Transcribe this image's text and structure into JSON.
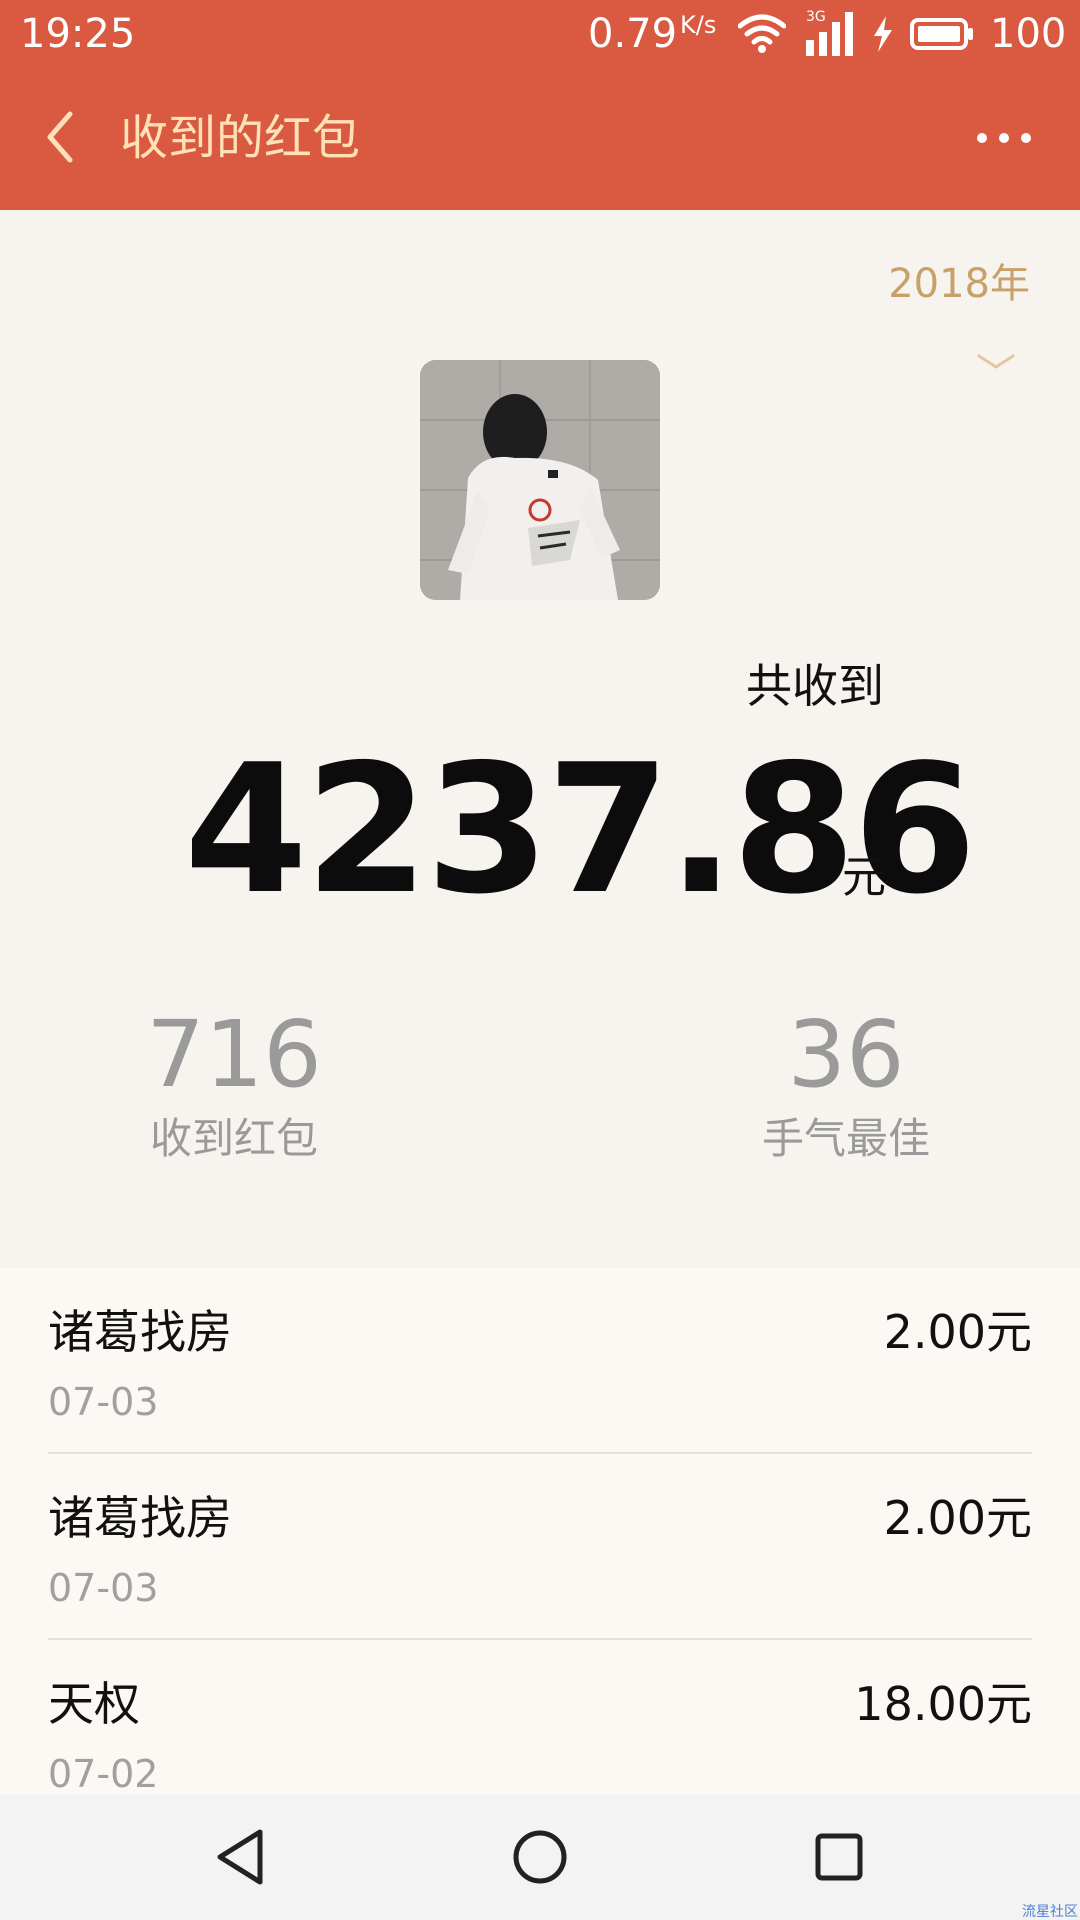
{
  "status_bar": {
    "time": "19:25",
    "network_speed": "0.79",
    "network_speed_unit": "K/s",
    "network_type": "3G",
    "battery_level": "100"
  },
  "app_bar": {
    "title": "收到的红包"
  },
  "year_picker": {
    "label": "2018年"
  },
  "summary": {
    "total_label": "共收到",
    "total_amount": "4237.86",
    "total_unit": "元",
    "stats": [
      {
        "value": "716",
        "label": "收到红包"
      },
      {
        "value": "36",
        "label": "手气最佳"
      }
    ]
  },
  "records": [
    {
      "name": "诸葛找房",
      "date": "07-03",
      "amount": "2.00元"
    },
    {
      "name": "诸葛找房",
      "date": "07-03",
      "amount": "2.00元"
    },
    {
      "name": "天权",
      "date": "07-02",
      "amount": "18.00元"
    }
  ],
  "watermark": "流星社区",
  "colors": {
    "header_bg": "#D95A40",
    "title_text": "#FFE1B8",
    "year_accent": "#C8A069",
    "page_bg": "#F7F4EF",
    "list_bg": "#FCF9F5"
  }
}
